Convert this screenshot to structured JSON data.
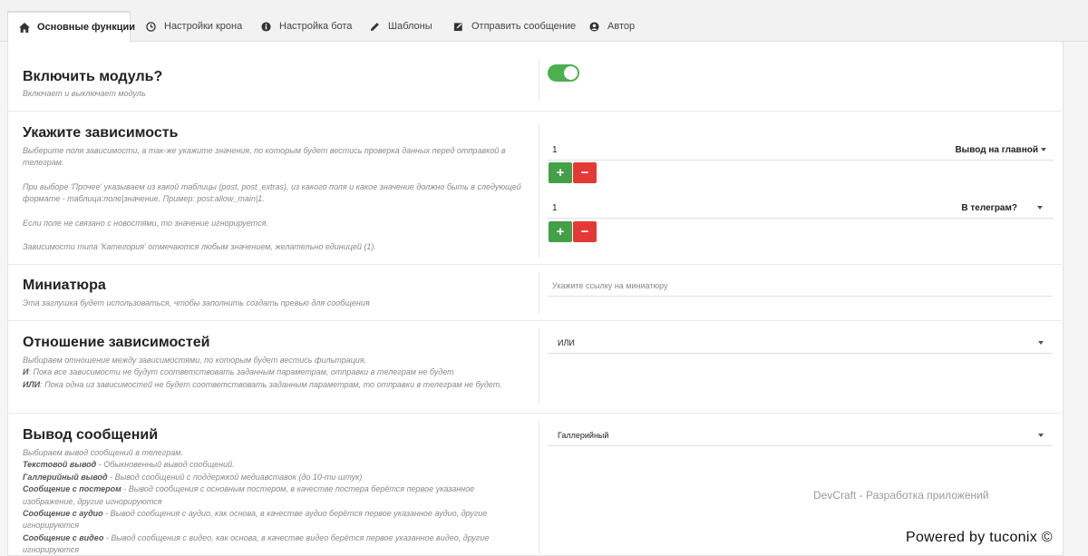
{
  "tabs": [
    {
      "label": "Основные функции",
      "icon": "home-icon"
    },
    {
      "label": "Настройки крона",
      "icon": "clock-icon"
    },
    {
      "label": "Настройка бота",
      "icon": "info-icon"
    },
    {
      "label": "Шаблоны",
      "icon": "pencil-icon"
    },
    {
      "label": "Отправить сообщение",
      "icon": "edit-icon"
    },
    {
      "label": "Автор",
      "icon": "user-icon"
    }
  ],
  "module": {
    "title": "Включить модуль?",
    "desc": "Включает и выключает модуль",
    "enabled": true,
    "accent": "#4caf50"
  },
  "dependency": {
    "title": "Укажите зависимость",
    "desc1": "Выберите поля зависимости, а так-же укажите значения, по которым будет вестись проверка данных перед отправкой в телеграм.",
    "desc2": "При выборе 'Прочее' указываем из какой таблицы (post, post_extras), из какого поля и какое значение должно быть в следующей формате - таблица:поле|значение. Пример: post:allow_main|1.",
    "desc3": "Если поле не связано с новостями, то значение игнорируется.",
    "desc4": "Зависимости типа 'Категория' отмечаются любым значением, желательно единицей (1).",
    "items": [
      {
        "value": "1",
        "field": "Вывод на главной"
      },
      {
        "value": "1",
        "field": "В телеграм?"
      }
    ],
    "plus": "+",
    "minus": "−"
  },
  "thumb": {
    "title": "Миниатюра",
    "desc": "Эта заглушка будет использоваться, чтобы заполнить создать превью для сообщения",
    "placeholder": "Укажите ссылку на миниатюру"
  },
  "relation": {
    "title": "Отношение зависимостей",
    "desc": "Выбираем отношение между зависимостями, по которым будет вестись фильтрация.",
    "and_label": "И",
    "and_text": ": Пока все зависимости не будут соответствовать заданным параметрам, отправки в телеграм не будет",
    "or_label": "ИЛИ",
    "or_text": ": Пока одна из зависимостей не будет соответствовать заданным параметрам, то отправки в телеграм не будет.",
    "value": "ИЛИ"
  },
  "output": {
    "title": "Вывод сообщений",
    "desc": "Выбираем вывод сообщений в телеграм.",
    "lines": [
      {
        "label": "Текстовой вывод",
        "text": " - Обыкновенный вывод сообщений."
      },
      {
        "label": "Галлерийный вывод",
        "text": " - Вывод сообщений с поддержкой медиавставок (до 10-ти штук)"
      },
      {
        "label": "Сообщение с постером",
        "text": " - Вывод сообщения с основным постером, в качестве постера берётся первое указанное изображение, другие игнорируются"
      },
      {
        "label": "Сообщение с аудио",
        "text": " - Вывод сообщения с аудио, как основа, в качестве аудио берётся первое указанное аудио, другие игнорируются"
      },
      {
        "label": "Сообщение с видео",
        "text": " - Вывод сообщения с видео, как основа, в качестве видео берётся первое указанное видео, другие игнорируются"
      }
    ],
    "value": "Галлерийный"
  },
  "watermark": "DevCraft - Разработка приложений",
  "powered": "Powered by tuconix ©"
}
